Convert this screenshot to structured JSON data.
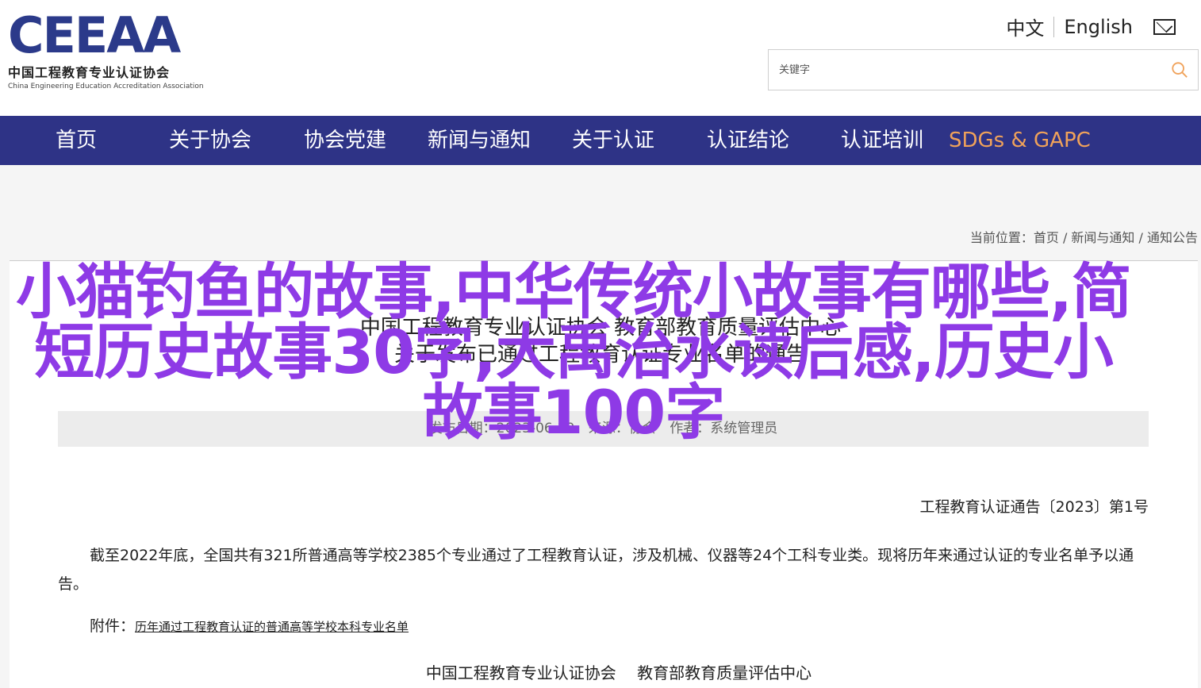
{
  "header": {
    "logo_mark": "CEEAA",
    "logo_cn": "中国工程教育专业认证协会",
    "logo_en": "China Engineering Education Accreditation Association",
    "lang_cn": "中文",
    "lang_en": "English",
    "mail_icon": "mail-icon"
  },
  "search": {
    "placeholder": "关键字",
    "icon": "search-icon"
  },
  "nav": {
    "items": [
      {
        "label": "首页"
      },
      {
        "label": "关于协会"
      },
      {
        "label": "协会党建"
      },
      {
        "label": "新闻与通知"
      },
      {
        "label": "关于认证"
      },
      {
        "label": "认证结论"
      },
      {
        "label": "认证培训"
      },
      {
        "label": "SDGs & GAPC"
      }
    ],
    "accent_color": "#f0a25a",
    "bg_color": "#2e3386"
  },
  "breadcrumb": {
    "text": "当前位置：首页 / 新闻与通知 / 通知公告"
  },
  "article": {
    "title_line1": "中国工程教育专业认证协会 教育部教育质量评估中心",
    "title_line2": "关于发布已通过工程教育认证专业名单的通告",
    "meta_date": "发布日期：2023-06-29",
    "meta_source": "来源：协会",
    "meta_author": "作者：系统管理员",
    "doc_no": "工程教育认证通告〔2023〕第1号",
    "paragraph": "截至2022年底，全国共有321所普通高等学校2385个专业通过了工程教育认证，涉及机械、仪器等24个工科专业类。现将历年来通过认证的专业名单予以通告。",
    "attach_label": "附件：",
    "attach_link": "历年通过工程教育认证的普通高等学校本科专业名单",
    "sign_1": "中国工程教育专业认证协会",
    "sign_2": "教育部教育质量评估中心"
  },
  "overlay": {
    "text": "小猫钓鱼的故事,中华传统小故事有哪些,简短历史故事30字,大禹治水读后感,历史小故事100字",
    "color": "#8e3ae6"
  }
}
